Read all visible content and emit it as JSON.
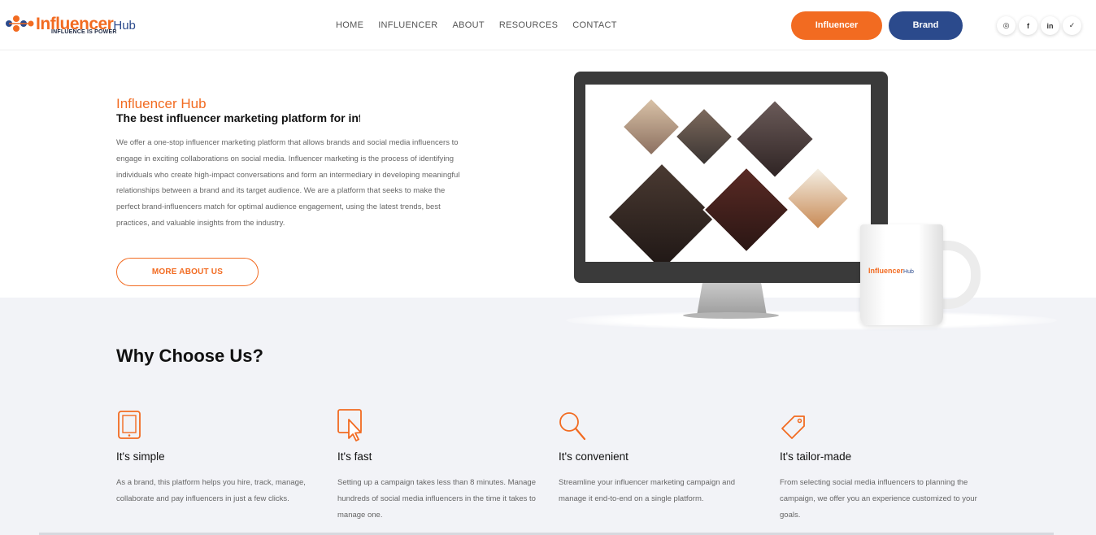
{
  "header": {
    "logo": {
      "name": "Influencer",
      "suffix": "Hub",
      "tagline": "INFLUENCE IS POWER"
    },
    "nav": [
      {
        "label": "HOME"
      },
      {
        "label": "INFLUENCER"
      },
      {
        "label": "ABOUT"
      },
      {
        "label": "RESOURCES"
      },
      {
        "label": "CONTACT"
      }
    ],
    "buttons": {
      "influencer": "Influencer",
      "brand": "Brand"
    },
    "socials": [
      {
        "icon": "instagram-icon",
        "glyph": "◎"
      },
      {
        "icon": "facebook-icon",
        "glyph": "f"
      },
      {
        "icon": "linkedin-icon",
        "glyph": "in"
      },
      {
        "icon": "twitter-icon",
        "glyph": "✓"
      }
    ]
  },
  "hero": {
    "title": "Influencer Hub",
    "subtitle": "The best influencer marketing platform for infl",
    "body": "We offer a one-stop influencer marketing platform that allows brands and social media influencers to engage in exciting collaborations on social media. Influencer marketing is the process of identifying individuals who create high-impact conversations and form an intermediary in developing meaningful relationships between a brand and its target audience. We are a platform that seeks to make the perfect brand-influencers match for optimal audience engagement, using the latest trends, best practices, and valuable insights from the industry.",
    "cta": "MORE ABOUT US",
    "mug_logo": {
      "name": "Influencer",
      "suffix": "Hub"
    }
  },
  "why": {
    "title": "Why Choose Us?",
    "features": [
      {
        "icon": "tablet-icon",
        "title": "It's simple",
        "text": "As a brand, this platform helps you hire, track, manage, collaborate and pay influencers in just a few clicks."
      },
      {
        "icon": "cursor-icon",
        "title": "It's fast",
        "text": "Setting up a campaign takes less than 8 minutes. Manage hundreds of social media influencers in the time it takes to manage one."
      },
      {
        "icon": "search-icon",
        "title": "It's convenient",
        "text": "Streamline your influencer marketing campaign and manage it end-to-end on a single platform."
      },
      {
        "icon": "tag-icon",
        "title": "It's tailor-made",
        "text": "From selecting social media influencers to planning the campaign, we offer you an experience customized to your goals."
      }
    ]
  },
  "colors": {
    "accent": "#f26b21",
    "brand": "#2b4a8c",
    "section_bg": "#f2f3f7"
  }
}
